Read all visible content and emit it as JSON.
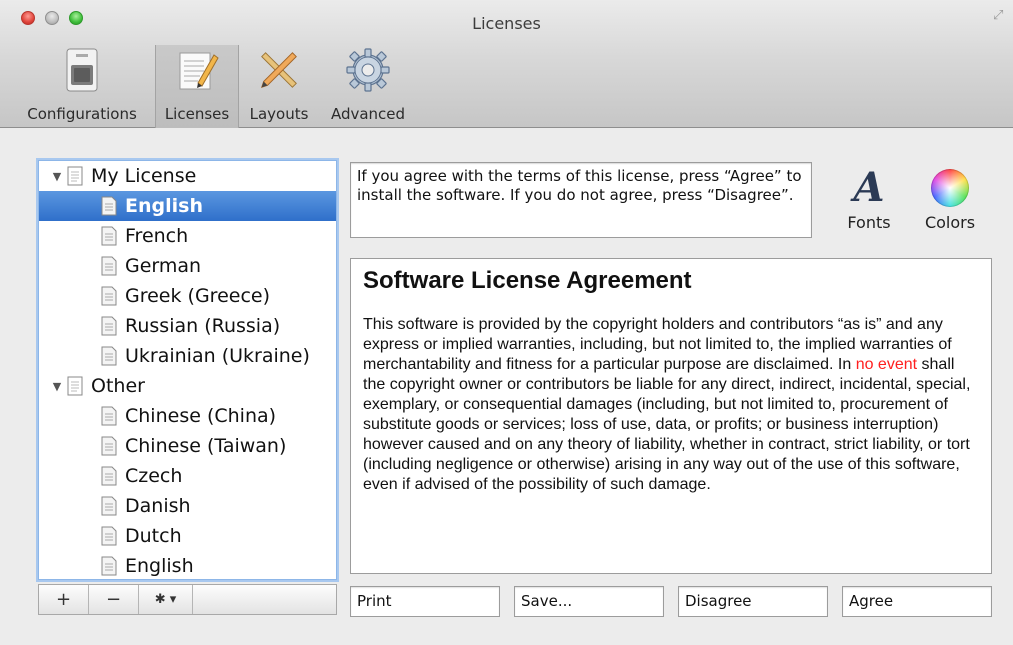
{
  "window": {
    "title": "Licenses"
  },
  "toolbar": {
    "items": [
      {
        "label": "Configurations",
        "icon": "configurations-icon"
      },
      {
        "label": "Licenses",
        "icon": "licenses-icon",
        "selected": true
      },
      {
        "label": "Layouts",
        "icon": "layouts-icon"
      },
      {
        "label": "Advanced",
        "icon": "gear-icon"
      }
    ]
  },
  "outline": {
    "groups": [
      {
        "label": "My License",
        "items": [
          "English",
          "French",
          "German",
          "Greek (Greece)",
          "Russian (Russia)",
          "Ukrainian (Ukraine)"
        ]
      },
      {
        "label": "Other",
        "items": [
          "Chinese (China)",
          "Chinese (Taiwan)",
          "Czech",
          "Danish",
          "Dutch",
          "English"
        ]
      }
    ],
    "selected": "English"
  },
  "bottom_bar": {
    "add": "+",
    "remove": "−",
    "action": "✱ ▾"
  },
  "description": "If you agree with the terms of this license, press “Agree” to install the software. If you do not agree, press “Disagree”.",
  "format_buttons": {
    "fonts": "Fonts",
    "colors": "Colors"
  },
  "license": {
    "title": "Software License Agreement",
    "body_before": "This software is provided by the copyright holders and contributors “as is” and any express or implied warranties, including, but not limited to, the implied warranties of merchantability and fitness for a particular purpose are disclaimed. In ",
    "body_highlight": "no event",
    "body_after": " shall the copyright owner or contributors be liable for any direct, indirect, incidental, special, exemplary, or consequential damages (including, but not limited to, procurement of substitute goods or services; loss of use, data, or profits; or business interruption) however caused and on any theory of liability, whether in contract, strict liability, or tort (including negligence or otherwise) arising in any way out of the use of this software, even if advised of the possibility of such damage.",
    "highlight_color": "#ff2020"
  },
  "button_labels": {
    "print": "Print",
    "save": "Save...",
    "disagree": "Disagree",
    "agree": "Agree"
  }
}
